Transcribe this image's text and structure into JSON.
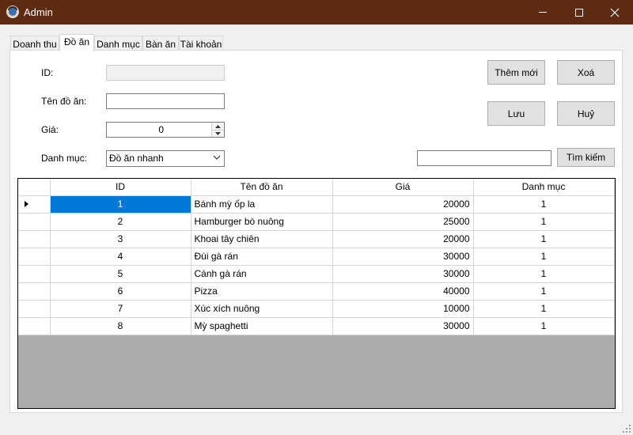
{
  "window": {
    "title": "Admin"
  },
  "tabs": [
    "Doanh thu",
    "Đồ ăn",
    "Danh mục",
    "Bàn ăn",
    "Tài khoản"
  ],
  "active_tab": "Đồ ăn",
  "form": {
    "id_label": "ID:",
    "id_value": "",
    "name_label": "Tên đồ ăn:",
    "name_value": "",
    "price_label": "Giá:",
    "price_value": "0",
    "category_label": "Danh mục:",
    "category_value": "Đồ ăn nhanh"
  },
  "buttons": {
    "add": "Thêm mới",
    "delete": "Xoá",
    "save": "Lưu",
    "cancel": "Huỷ",
    "search": "Tìm kiếm"
  },
  "search": {
    "value": ""
  },
  "table": {
    "columns": [
      "ID",
      "Tên đồ ăn",
      "Giá",
      "Danh mục"
    ],
    "rows": [
      [
        "1",
        "Bánh mỳ ốp la",
        "20000",
        "1"
      ],
      [
        "2",
        "Hamburger bò nuông",
        "25000",
        "1"
      ],
      [
        "3",
        "Khoai tây chiên",
        "20000",
        "1"
      ],
      [
        "4",
        "Đùi gà rán",
        "30000",
        "1"
      ],
      [
        "5",
        "Cánh gà rán",
        "30000",
        "1"
      ],
      [
        "6",
        "Pizza",
        "40000",
        "1"
      ],
      [
        "7",
        "Xúc xích nuông",
        "10000",
        "1"
      ],
      [
        "8",
        "Mỳ spaghetti",
        "30000",
        "1"
      ]
    ],
    "selected_row": 0
  },
  "colors": {
    "titlebar": "#5e2a12",
    "selection": "#0078d7"
  }
}
